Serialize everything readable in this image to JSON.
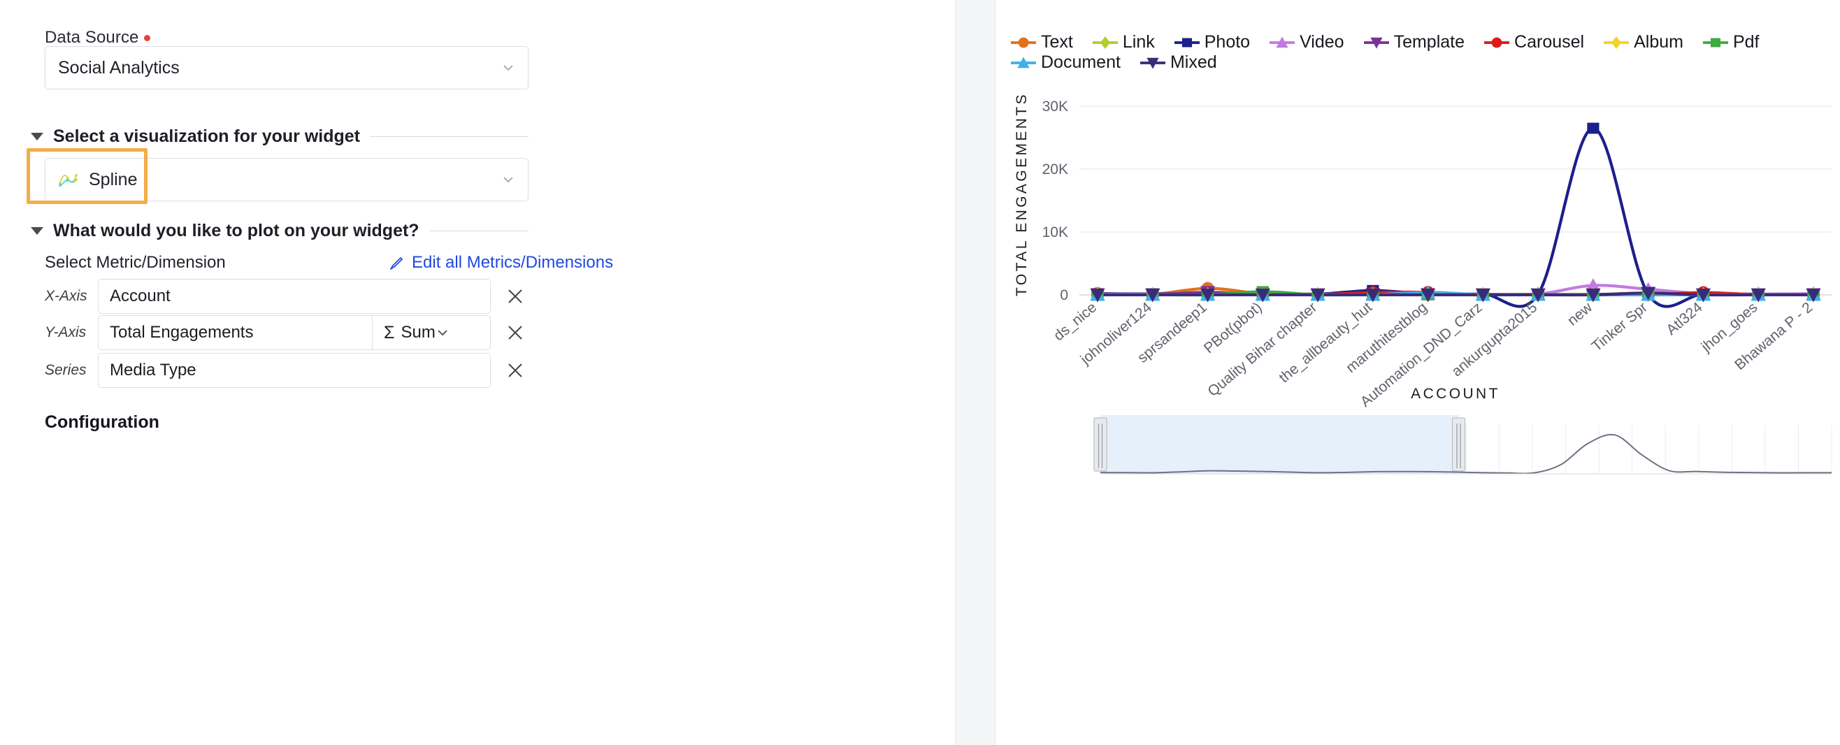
{
  "left_panel": {
    "data_source": {
      "label": "Data Source",
      "required": true,
      "value": "Social Analytics"
    },
    "visualization_section": {
      "title": "Select a visualization for your widget",
      "selected": "Spline",
      "icon": "spline-icon",
      "highlighted": true,
      "highlight_color": "#f5ac49"
    },
    "plot_section": {
      "title": "What would you like to plot on your widget?",
      "subtitle": "Select Metric/Dimension",
      "edit_link": "Edit all Metrics/Dimensions",
      "edit_link_color": "#1f49e0",
      "rows": [
        {
          "label": "X-Axis",
          "value": "Account",
          "aggregation": null,
          "has_remove": true
        },
        {
          "label": "Y-Axis",
          "value": "Total Engagements",
          "aggregation": "Sum",
          "aggregation_symbol": "Σ",
          "has_remove": true
        },
        {
          "label": "Series",
          "value": "Media Type",
          "aggregation": null,
          "has_remove": true
        }
      ]
    },
    "configuration_heading": "Configuration"
  },
  "chart_data": {
    "type": "line",
    "title": "",
    "xlabel": "ACCOUNT",
    "ylabel": "TOTAL ENGAGEMENTS",
    "ylim": [
      0,
      32000
    ],
    "yticks": [
      0,
      10000,
      20000,
      30000
    ],
    "ytick_labels": [
      "0",
      "10K",
      "20K",
      "30K"
    ],
    "grid": true,
    "legend_position": "top",
    "categories": [
      "ds_nice",
      "johnoliver124",
      "sprsandeep1",
      "PBot(pbot)",
      "Quality Bihar chapter",
      "the_allbeauty_hut",
      "maruthitestblog",
      "Automation_DND_Carz",
      "ankurgupta2015",
      "new",
      "Tinker Spr",
      "Atl324",
      "jhon_goes",
      "Bhawana P - 2"
    ],
    "series": [
      {
        "name": "Text",
        "color": "#e2711d",
        "marker": "circle",
        "values": [
          260,
          120,
          1050,
          200,
          60,
          40,
          40,
          30,
          30,
          30,
          320,
          40,
          30,
          30
        ]
      },
      {
        "name": "Link",
        "color": "#b5cc2e",
        "marker": "diamond",
        "values": [
          60,
          60,
          60,
          60,
          60,
          60,
          60,
          60,
          120,
          120,
          120,
          120,
          120,
          120
        ]
      },
      {
        "name": "Photo",
        "color": "#1b1f8c",
        "marker": "square",
        "values": [
          180,
          170,
          220,
          320,
          140,
          700,
          180,
          140,
          120,
          26500,
          120,
          110,
          150,
          160
        ]
      },
      {
        "name": "Video",
        "color": "#c07be0",
        "marker": "triangle",
        "values": [
          120,
          120,
          120,
          120,
          120,
          120,
          120,
          120,
          140,
          1500,
          900,
          200,
          150,
          200
        ]
      },
      {
        "name": "Template",
        "color": "#7b3294",
        "marker": "triangle-down",
        "values": [
          60,
          60,
          420,
          60,
          60,
          60,
          60,
          60,
          60,
          60,
          260,
          60,
          60,
          60
        ]
      },
      {
        "name": "Carousel",
        "color": "#e01b1b",
        "marker": "circle",
        "values": [
          40,
          40,
          40,
          40,
          40,
          380,
          420,
          40,
          40,
          40,
          40,
          380,
          40,
          40
        ]
      },
      {
        "name": "Album",
        "color": "#f2d327",
        "marker": "diamond",
        "values": [
          30,
          30,
          30,
          30,
          30,
          30,
          30,
          30,
          30,
          30,
          30,
          30,
          30,
          30
        ]
      },
      {
        "name": "Pdf",
        "color": "#3faa3f",
        "marker": "square",
        "values": [
          30,
          30,
          30,
          520,
          30,
          30,
          30,
          30,
          30,
          30,
          30,
          30,
          30,
          30
        ]
      },
      {
        "name": "Document",
        "color": "#3fb0e8",
        "marker": "triangle",
        "values": [
          30,
          30,
          30,
          30,
          30,
          30,
          400,
          30,
          30,
          30,
          30,
          30,
          30,
          30
        ]
      },
      {
        "name": "Mixed",
        "color": "#3b2a7a",
        "marker": "triangle-down",
        "values": [
          20,
          20,
          20,
          20,
          20,
          20,
          20,
          20,
          20,
          20,
          300,
          20,
          20,
          20
        ]
      }
    ],
    "navigator": {
      "visible": true,
      "selection_start_pct": 0.0,
      "selection_end_pct": 0.49,
      "selection_fill": "#e6f0fb"
    }
  }
}
